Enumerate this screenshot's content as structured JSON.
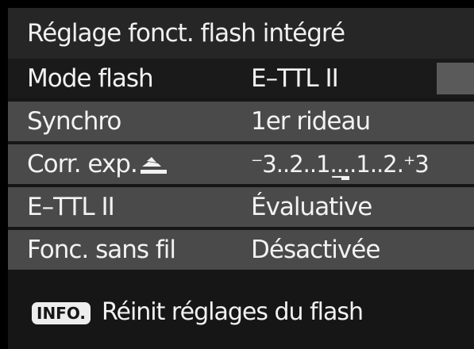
{
  "title": "Réglage fonct. flash intégré",
  "menu": {
    "rows": [
      {
        "label": "Mode flash",
        "value": "E–TTL II",
        "selected": true
      },
      {
        "label": "Synchro",
        "value": "1er rideau",
        "selected": false
      },
      {
        "label": "Corr. exp.",
        "value": "⁻3..2..1..̲..1..2.⁺3",
        "icon": "flash-exposure-icon",
        "selected": false
      },
      {
        "label": "E–TTL II",
        "value": "Évaluative",
        "selected": false
      },
      {
        "label": "Fonc. sans fil",
        "value": "Désactivée",
        "selected": false
      }
    ],
    "exposure_scale": {
      "min": -3,
      "max": 3,
      "current": 0,
      "display": "⁻3..2..1..0..1..2.⁺3"
    }
  },
  "footer": {
    "button_label": "INFO.",
    "text": "Réinit réglages du flash"
  },
  "colors": {
    "background": "#161616",
    "title_bar": "#262626",
    "row_normal": "#4a4a4a",
    "row_selected": "#1a1a1a",
    "text": "#f2f2f2"
  }
}
